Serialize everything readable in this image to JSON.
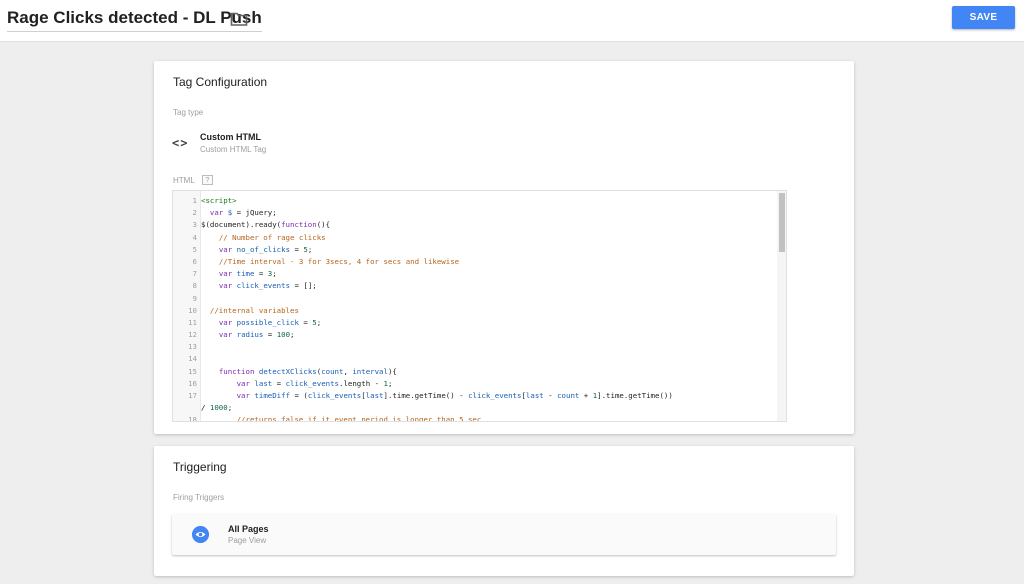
{
  "header": {
    "title": "Rage Clicks detected - DL Push",
    "save_label": "SAVE"
  },
  "tag_config": {
    "title": "Tag Configuration",
    "tag_type_label": "Tag type",
    "tag_type_name": "Custom HTML",
    "tag_type_sub": "Custom HTML Tag",
    "html_label": "HTML",
    "help": "?",
    "code_lines": [
      {
        "n": "1",
        "segs": [
          {
            "t": "<script>",
            "c": "tg"
          }
        ]
      },
      {
        "n": "2",
        "segs": [
          {
            "t": "  "
          },
          {
            "t": "var",
            "c": "kw"
          },
          {
            "t": " "
          },
          {
            "t": "$",
            "c": "vr"
          },
          {
            "t": " = jQuery;"
          }
        ]
      },
      {
        "n": "3",
        "segs": [
          {
            "t": "$(document).ready("
          },
          {
            "t": "function",
            "c": "kw"
          },
          {
            "t": "(){"
          }
        ]
      },
      {
        "n": "4",
        "segs": [
          {
            "t": "    "
          },
          {
            "t": "// Number of rage clicks",
            "c": "cm"
          }
        ]
      },
      {
        "n": "5",
        "segs": [
          {
            "t": "    "
          },
          {
            "t": "var",
            "c": "kw"
          },
          {
            "t": " "
          },
          {
            "t": "no_of_clicks",
            "c": "vr"
          },
          {
            "t": " = "
          },
          {
            "t": "5",
            "c": "nm"
          },
          {
            "t": ";"
          }
        ]
      },
      {
        "n": "6",
        "segs": [
          {
            "t": "    "
          },
          {
            "t": "//Time interval - 3 for 3secs, 4 for secs and likewise",
            "c": "cm"
          }
        ]
      },
      {
        "n": "7",
        "segs": [
          {
            "t": "    "
          },
          {
            "t": "var",
            "c": "kw"
          },
          {
            "t": " "
          },
          {
            "t": "time",
            "c": "vr"
          },
          {
            "t": " = "
          },
          {
            "t": "3",
            "c": "nm"
          },
          {
            "t": ";"
          }
        ]
      },
      {
        "n": "8",
        "segs": [
          {
            "t": "    "
          },
          {
            "t": "var",
            "c": "kw"
          },
          {
            "t": " "
          },
          {
            "t": "click_events",
            "c": "vr"
          },
          {
            "t": " = [];"
          }
        ]
      },
      {
        "n": "9",
        "segs": []
      },
      {
        "n": "10",
        "segs": [
          {
            "t": "  "
          },
          {
            "t": "//internal variables",
            "c": "cm"
          }
        ]
      },
      {
        "n": "11",
        "segs": [
          {
            "t": "    "
          },
          {
            "t": "var",
            "c": "kw"
          },
          {
            "t": " "
          },
          {
            "t": "possible_click",
            "c": "vr"
          },
          {
            "t": " = "
          },
          {
            "t": "5",
            "c": "nm"
          },
          {
            "t": ";"
          }
        ]
      },
      {
        "n": "12",
        "segs": [
          {
            "t": "    "
          },
          {
            "t": "var",
            "c": "kw"
          },
          {
            "t": " "
          },
          {
            "t": "radius",
            "c": "vr"
          },
          {
            "t": " = "
          },
          {
            "t": "100",
            "c": "nm"
          },
          {
            "t": ";"
          }
        ]
      },
      {
        "n": "13",
        "segs": []
      },
      {
        "n": "14",
        "segs": []
      },
      {
        "n": "15",
        "segs": [
          {
            "t": "    "
          },
          {
            "t": "function",
            "c": "kw"
          },
          {
            "t": " "
          },
          {
            "t": "detectXClicks",
            "c": "vr"
          },
          {
            "t": "("
          },
          {
            "t": "count",
            "c": "vr"
          },
          {
            "t": ", "
          },
          {
            "t": "interval",
            "c": "vr"
          },
          {
            "t": "){"
          }
        ]
      },
      {
        "n": "16",
        "segs": [
          {
            "t": "        "
          },
          {
            "t": "var",
            "c": "kw"
          },
          {
            "t": " "
          },
          {
            "t": "last",
            "c": "vr"
          },
          {
            "t": " = "
          },
          {
            "t": "click_events",
            "c": "vr"
          },
          {
            "t": ".length - "
          },
          {
            "t": "1",
            "c": "nm"
          },
          {
            "t": ";"
          }
        ]
      },
      {
        "n": "17",
        "segs": [
          {
            "t": "        "
          },
          {
            "t": "var",
            "c": "kw"
          },
          {
            "t": " "
          },
          {
            "t": "timeDiff",
            "c": "vr"
          },
          {
            "t": " = ("
          },
          {
            "t": "click_events",
            "c": "vr"
          },
          {
            "t": "["
          },
          {
            "t": "last",
            "c": "vr"
          },
          {
            "t": "].time.getTime() - "
          },
          {
            "t": "click_events",
            "c": "vr"
          },
          {
            "t": "["
          },
          {
            "t": "last",
            "c": "vr"
          },
          {
            "t": " - "
          },
          {
            "t": "count",
            "c": "vr"
          },
          {
            "t": " + "
          },
          {
            "t": "1",
            "c": "nm"
          },
          {
            "t": "].time.getTime())"
          }
        ]
      },
      {
        "n": "",
        "segs": [
          {
            "t": "/ "
          },
          {
            "t": "1000",
            "c": "nm"
          },
          {
            "t": ";"
          }
        ]
      },
      {
        "n": "18",
        "segs": [
          {
            "t": "        "
          },
          {
            "t": "//returns false if it event period is longer than 5 sec",
            "c": "cm"
          }
        ]
      }
    ]
  },
  "triggering": {
    "title": "Triggering",
    "firing_label": "Firing Triggers",
    "trigger_name": "All Pages",
    "trigger_sub": "Page View"
  },
  "colors": {
    "accent": "#4285f4",
    "keyword": "#7a2bb5",
    "variable": "#1a5fb4",
    "comment": "#b5651d"
  },
  "icons": {
    "folder": "folder-icon",
    "tag_type": "code-brackets-icon",
    "help": "help-icon",
    "trigger": "eye-icon"
  }
}
